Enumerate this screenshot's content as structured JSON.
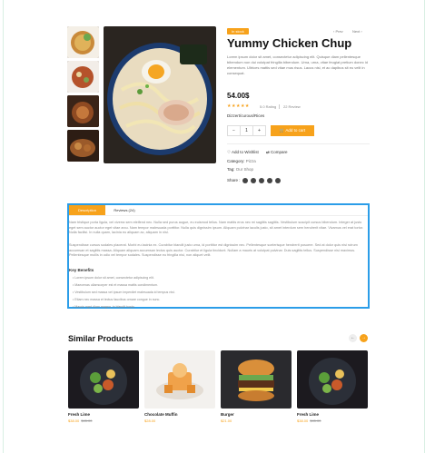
{
  "badge": "In stock",
  "nav": {
    "prev": "Prev",
    "next": "Next"
  },
  "product": {
    "title": "Yummy Chicken Chup",
    "description": "Lorem ipsum dolor sit amet, consectetur adipiscing elit. Quisque diam pellentesque bibendum non dui volutpat fringilla bibendum. Urna, urna, vitae feugiat pretium donec id elementum. Ultrices mattis sed vitae mus risus. Lacus nisi, et ac dapibus sit eu velit in consequat.",
    "price": "54.00$",
    "stars": "★★★★★",
    "rating": "5.0 Rating",
    "reviews": "22 Review",
    "diet_label": "Dizzert/curous/Rices",
    "qty_minus": "−",
    "qty_value": "1",
    "qty_plus": "+",
    "add_to_cart": "Add to cart",
    "wishlist": "Add to Wishlist",
    "compare": "Compare",
    "category_label": "Category:",
    "category_value": "Pizza",
    "tag_label": "Tag:",
    "tag_value": "Our Shop",
    "share_label": "Share :"
  },
  "tabs": {
    "description": "Description",
    "reviews": "Reviews (24)",
    "para1": "Nam tristique porta ligula, vel viverra sem eleifend nec. Nulla sed purus augue, eu euismod tellus. Nam mattis eros nec mi sagittis sagittis. Vestibulum suscipit cursus bibendum. Integer at justo eget sem auctor auctor eget vitae arcu. Nam tempor malesuada porttitor. Nulla quis dignissim ipsum. Aliquam pulvinar iaculis justo, sit amet interdum sem hendrerit vitae. Vivamus vel erat tortor. Nulla facilisi. In nulla quam, lacinia eu aliquam ac, aliquam in nisl.",
    "para2": "Suspendisse cursus sodales placerat. Morbi eu lacinia ex. Curabitur blandit justo urna, id porttitor est dignissim nec. Pellentesque scelerisque hendrerit posuere. Sed at dolor quis nisi rutrum accumsan et sagittis massa. Aliquam aliquam accumsan lectus quis auctor. Curabitur et ligula tincidunt. Nullam a mauris at volutpat pulvinar. Duis sagittis tellus. Suspendisse nisi maximus. Pellentesque mollis in odio vel tempor sodales. Suspendisse eu fringilla nisi, non aliquet velit.",
    "key_benefits": "Key Benefits",
    "bullets": [
      "Lorem ipsum dolor sit amet, consectetur adipiscing elit.",
      "Maecenas ullamcorper est et massa mattis condimentum.",
      "Vestibulum sed massa vel ipsum imperdiet malesuada id tempus nisl.",
      "Etiam nec massa et lectus faucibus ornare congue in nunc.",
      "Mauris eget diam magna, in blandit turpis."
    ]
  },
  "similar": {
    "title": "Similar Products",
    "prev": "←",
    "next": "→",
    "items": [
      {
        "name": "Fresh Lime",
        "price": "$38.00",
        "old_price": "$45.00"
      },
      {
        "name": "Chocolate Muffin",
        "price": "$28.00",
        "old_price": ""
      },
      {
        "name": "Burger",
        "price": "$21.00",
        "old_price": ""
      },
      {
        "name": "Fresh Lime",
        "price": "$38.00",
        "old_price": "$45.00"
      }
    ]
  },
  "colors": {
    "accent": "#f7a21b",
    "highlight_border": "#2b9de8"
  },
  "icons": [
    "heart-icon",
    "compare-icon",
    "cart-icon",
    "chevron-left-icon",
    "chevron-right-icon",
    "arrow-left-icon",
    "arrow-right-icon"
  ]
}
